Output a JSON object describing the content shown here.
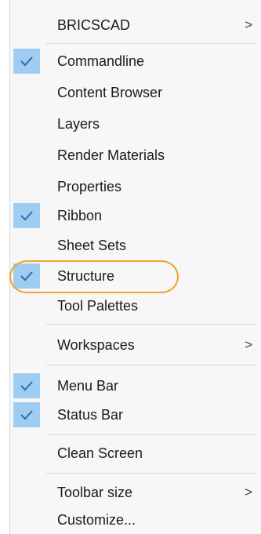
{
  "menu": {
    "items": [
      {
        "label": "BRICSCAD",
        "checked": false,
        "submenu": true
      },
      {
        "label": "Commandline",
        "checked": true,
        "submenu": false
      },
      {
        "label": "Content Browser",
        "checked": false,
        "submenu": false
      },
      {
        "label": "Layers",
        "checked": false,
        "submenu": false
      },
      {
        "label": "Render Materials",
        "checked": false,
        "submenu": false
      },
      {
        "label": "Properties",
        "checked": false,
        "submenu": false
      },
      {
        "label": "Ribbon",
        "checked": true,
        "submenu": false
      },
      {
        "label": "Sheet Sets",
        "checked": false,
        "submenu": false
      },
      {
        "label": "Structure",
        "checked": true,
        "submenu": false,
        "highlighted": true
      },
      {
        "label": "Tool Palettes",
        "checked": false,
        "submenu": false
      },
      {
        "label": "Workspaces",
        "checked": false,
        "submenu": true
      },
      {
        "label": "Menu Bar",
        "checked": true,
        "submenu": false
      },
      {
        "label": "Status Bar",
        "checked": true,
        "submenu": false
      },
      {
        "label": "Clean Screen",
        "checked": false,
        "submenu": false
      },
      {
        "label": "Toolbar size",
        "checked": false,
        "submenu": true
      },
      {
        "label": "Customize...",
        "checked": false,
        "submenu": false
      }
    ],
    "submenu_arrow": ">"
  },
  "colors": {
    "check_bg": "#9fcdf2",
    "check_mark": "#2a6db5",
    "highlight_ring": "#f0a330"
  }
}
